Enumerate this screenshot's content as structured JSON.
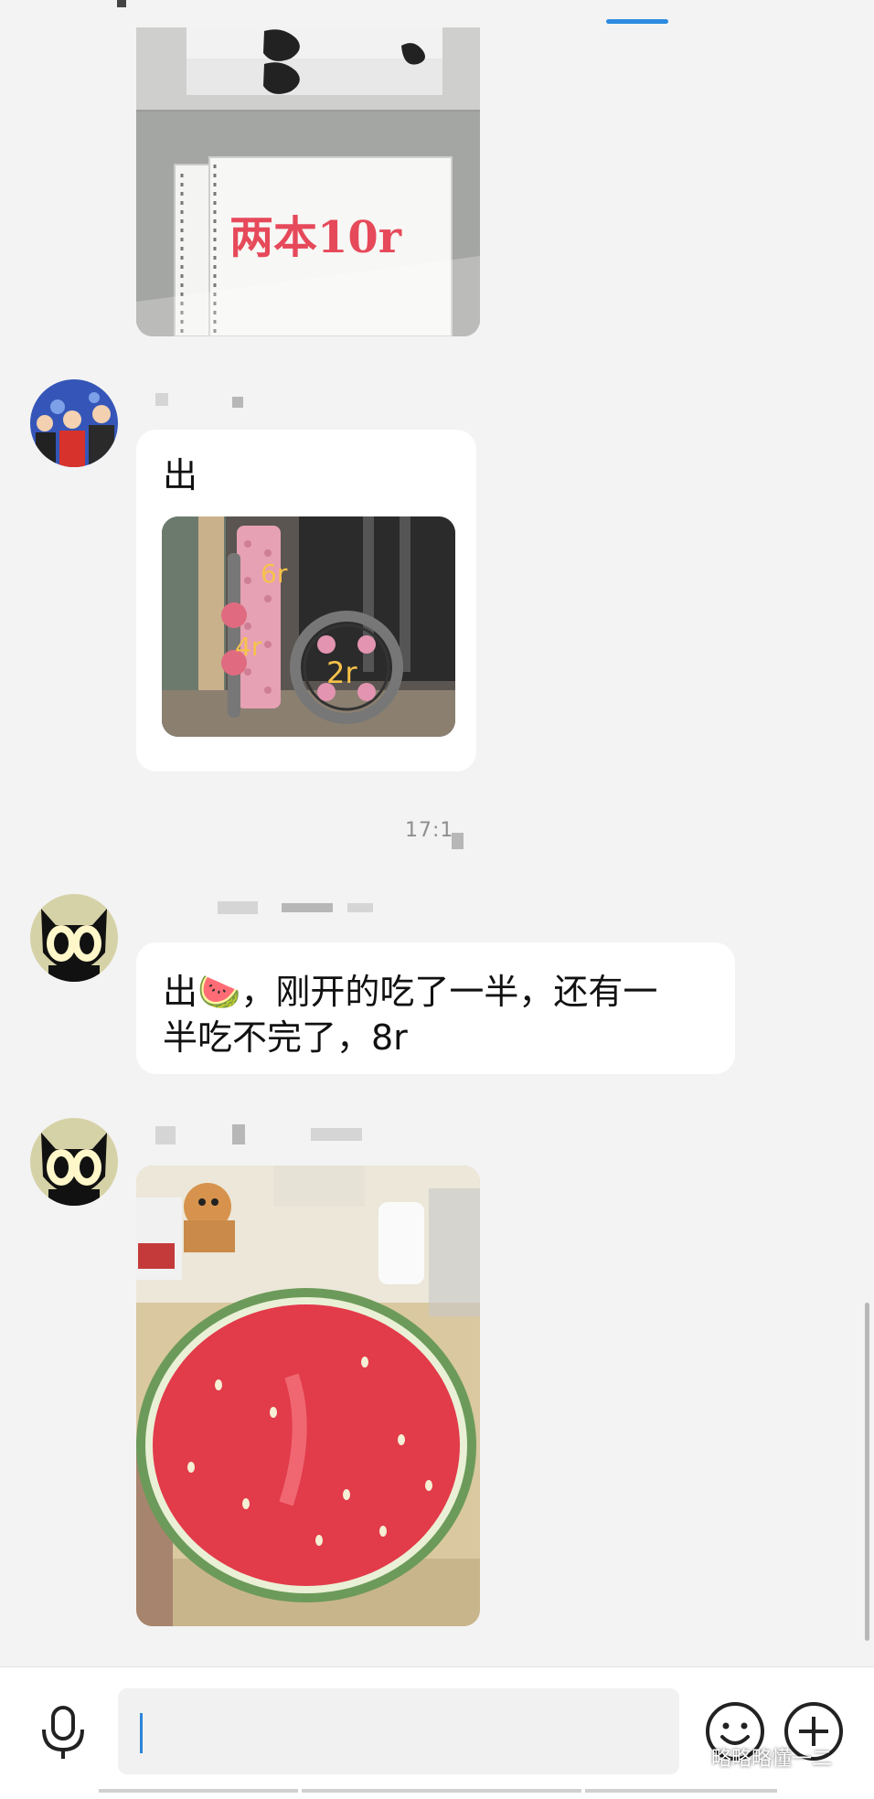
{
  "messages": {
    "m1": {
      "caption": "两本10r"
    },
    "m2": {
      "text": "出",
      "tags": [
        "6r",
        "4r",
        "2r"
      ]
    },
    "timestamp": "17:1",
    "m3": {
      "text_line1": "出🍉，刚开的吃了一半，还有一",
      "text_line2": "半吃不完了，8r"
    }
  },
  "watermark": "略略略懂一二",
  "icons": {
    "voice": "microphone-icon",
    "emoji": "emoji-icon",
    "plus": "plus-circle-icon"
  },
  "colors": {
    "accent": "#2d8be0",
    "background": "#f3f3f3",
    "bubble": "#ffffff",
    "watermelon": "#e23b4a"
  }
}
